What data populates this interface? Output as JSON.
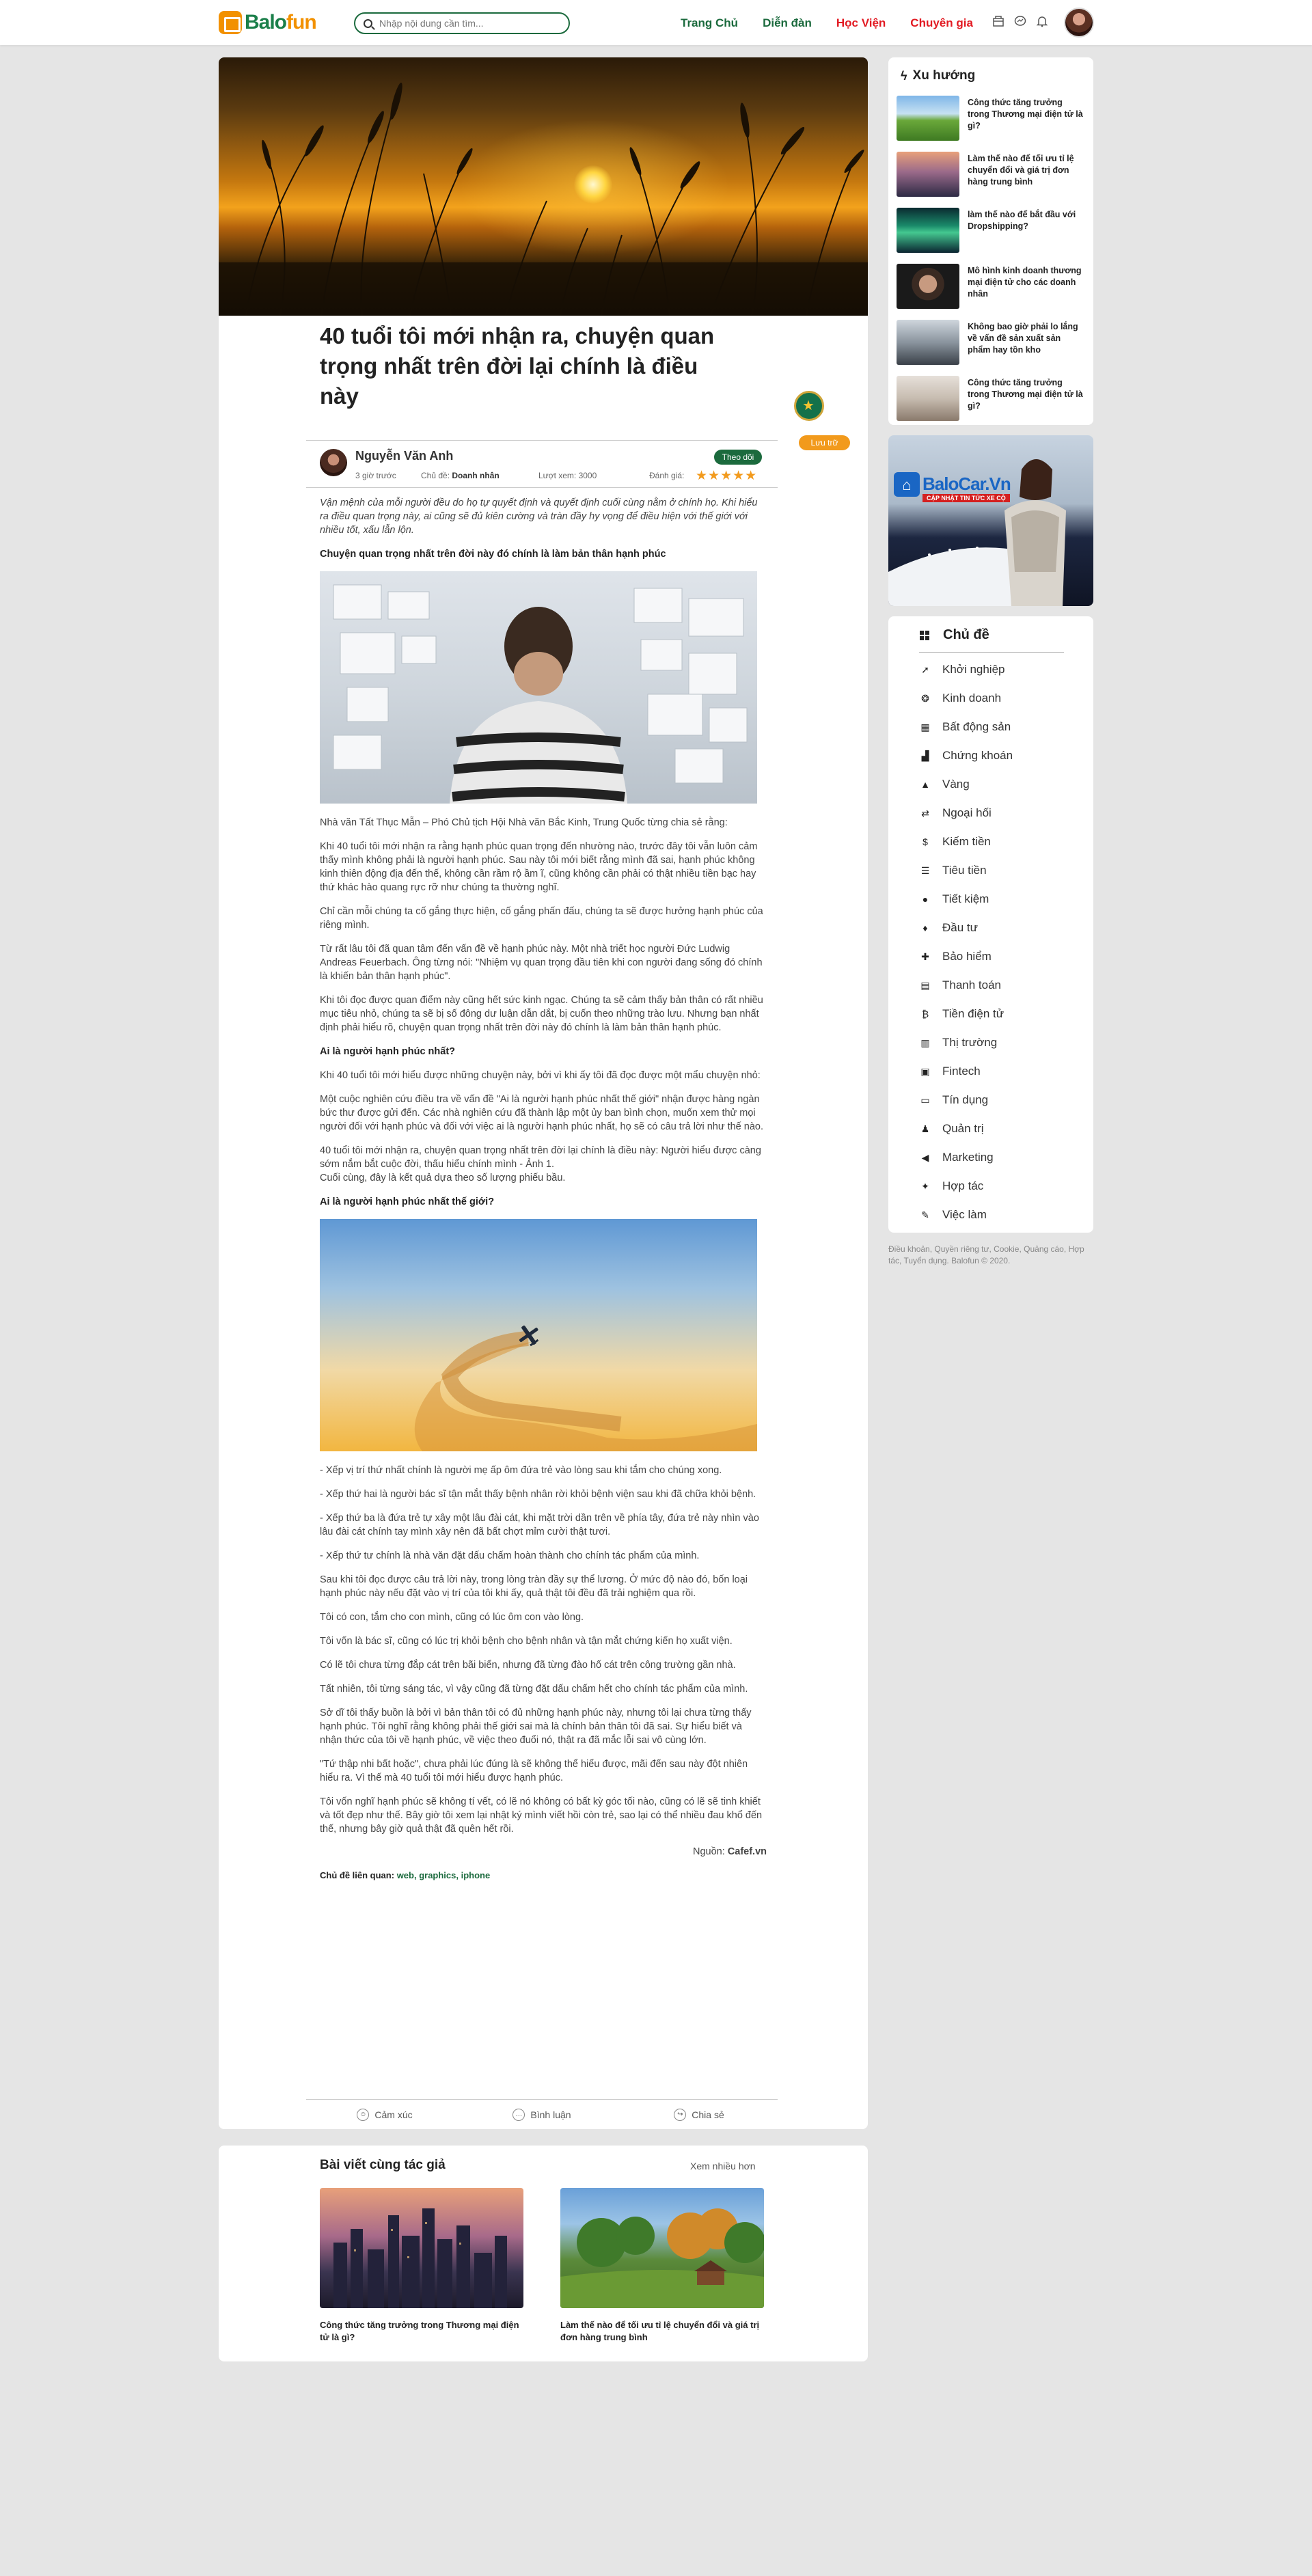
{
  "header": {
    "logo_text_a": "Balo",
    "logo_text_b": "fun",
    "search_placeholder": "Nhập nội dung cần tìm...",
    "nav": [
      {
        "label": "Trang Chủ",
        "color": "#1b6a3d"
      },
      {
        "label": "Diễn đàn",
        "color": "#1b6a3d"
      },
      {
        "label": "Học Viện",
        "color": "#e21b23"
      },
      {
        "label": "Chuyên gia",
        "color": "#e21b23"
      }
    ],
    "icons": [
      "bookmark-icon",
      "messenger-icon",
      "bell-icon"
    ]
  },
  "article": {
    "title": "40 tuổi tôi mới nhận ra, chuyện quan trọng nhất trên đời lại chính là điều này",
    "save_label": "Lưu trữ",
    "author": "Nguyễn Văn Anh",
    "follow_label": "Theo dõi",
    "time": "3 giờ trước",
    "topic_label": "Chủ đề:",
    "topic_value": "Doanh nhân",
    "views": "Lượt xem: 3000",
    "rating_label": "Đánh giá:",
    "rating": 5,
    "lead": "Vận mệnh của mỗi người đều do họ tự quyết định và quyết định cuối cùng nằm ở chính họ. Khi hiểu ra điều quan trọng này, ai cũng sẽ đủ kiên cường và tràn đầy hy vọng để điều hiện với thế giới với nhiều tốt, xấu lẫn lộn.",
    "h1": "Chuyện quan trọng nhất trên đời này đó chính là làm bản thân hạnh phúc",
    "p1": "Nhà văn Tất Thục Mẫn – Phó Chủ tịch Hội Nhà văn Bắc Kinh, Trung Quốc từng chia sẻ rằng:",
    "p2": "Khi 40 tuổi tôi mới nhận ra rằng hạnh phúc quan trọng đến nhường nào, trước đây tôi vẫn luôn cảm thấy mình không phải là người hạnh phúc. Sau này tôi mới biết rằng mình đã sai, hạnh phúc không kinh thiên động địa đến thế, không cần rầm rộ ầm ĩ, cũng không cần phải có thật nhiều tiền bạc hay thứ khác hào quang rực rỡ như chúng ta thường nghĩ.",
    "p3": "Chỉ cần mỗi chúng ta cố gắng thực hiện, cố gắng phấn đấu, chúng ta sẽ được hưởng hạnh phúc của riêng mình.",
    "p4": "Từ rất lâu tôi đã quan tâm đến vấn đề về hạnh phúc này. Một nhà triết học người Đức Ludwig Andreas Feuerbach. Ông từng nói: \"Nhiệm vụ quan trọng đầu tiên khi con người đang sống đó chính là khiến bản thân hạnh phúc\".",
    "p5": "Khi tôi đọc được quan điểm này cũng hết sức kinh ngạc. Chúng ta sẽ cảm thấy bản thân có rất nhiều mục tiêu nhỏ, chúng ta sẽ bị số đông dư luận dẫn dắt, bị cuốn theo những trào lưu. Nhưng bạn nhất định phải hiểu rõ, chuyện quan trọng nhất trên đời này đó chính là làm bản thân hạnh phúc.",
    "h2": "Ai là người hạnh phúc nhất?",
    "p6": "Khi 40 tuổi tôi mới hiểu được những chuyện này, bởi vì khi ấy tôi đã đọc được một mẩu chuyện nhỏ:",
    "p7": "Một cuộc nghiên cứu điều tra về vấn đề \"Ai là người hạnh phúc nhất thế giới\" nhận được hàng ngàn bức thư được gửi đến. Các nhà nghiên cứu đã thành lập một ủy ban bình chọn, muốn xem thử mọi người đối với hạnh phúc và đối với việc ai là người hạnh phúc nhất, họ sẽ có câu trả lời như thế nào.",
    "p8a": "40 tuổi tôi mới nhận ra, chuyện quan trọng nhất trên đời lại chính là điều này: Người hiểu được càng sớm nắm bắt cuộc đời, thấu hiểu chính mình - Ảnh 1.",
    "p8b": "Cuối cùng, đây là kết quả dựa theo số lượng phiếu bầu.",
    "h3": "Ai là người hạnh phúc nhất thế giới?",
    "b1": "- Xếp vị trí thứ nhất chính là người mẹ ấp ôm đứa trẻ vào lòng sau khi tắm cho chúng xong.",
    "b2": "- Xếp thứ hai là người bác sĩ tận mắt thấy bệnh nhân rời khỏi bệnh viện sau khi đã chữa khỏi bệnh.",
    "b3": "- Xếp thứ ba là đứa trẻ tự xây một lâu đài cát, khi mặt trời dần trên về phía tây, đứa trẻ này nhìn vào lâu đài cát chính tay mình xây nên đã bất chợt mỉm cười thật tươi.",
    "b4": "- Xếp thứ tư chính là nhà văn đặt dấu chấm hoàn thành cho chính tác phẩm của mình.",
    "p9": "Sau khi tôi đọc được câu trả lời này, trong lòng tràn đầy sự thể lương. Ở mức độ nào đó, bốn loại hạnh phúc này nếu đặt vào vị trí của tôi khi ấy, quả thật tôi đều đã trải nghiệm qua rồi.",
    "p10": "Tôi có con, tắm cho con mình, cũng có lúc ôm con vào lòng.",
    "p11": "Tôi vốn là bác sĩ, cũng có lúc trị khỏi bệnh cho bệnh nhân và tận mắt chứng kiến họ xuất viện.",
    "p12": "Có lẽ tôi chưa từng đắp cát trên bãi biển, nhưng đã từng đào hố cát trên công trường gần nhà.",
    "p13": "Tất nhiên, tôi từng sáng tác, vì vậy cũng đã từng đặt dấu chấm hết cho chính tác phẩm của mình.",
    "p14": "Sở dĩ tôi thấy buồn là bởi vì bản thân tôi có đủ những hạnh phúc này, nhưng tôi lại chưa từng thấy hạnh phúc. Tôi nghĩ rằng không phải thế giới sai mà là chính bản thân tôi đã sai. Sự hiểu biết và nhận thức của tôi về hạnh phúc, về việc theo đuổi nó, thật ra đã mắc lỗi sai vô cùng lớn.",
    "p15": "\"Tứ thập nhi bất hoặc\", chưa phải lúc đúng là sẽ không thể hiểu được, mãi đến sau này đột nhiên hiểu ra. Vì thế mà 40 tuổi tôi mới hiểu được hạnh phúc.",
    "p16": "Tôi vốn nghĩ hạnh phúc sẽ không tí vết, có lẽ nó không có bất kỳ góc tối nào, cũng có lẽ sẽ tinh khiết và tốt đẹp như thế. Bây giờ tôi xem lại nhật ký mình viết hồi còn trẻ, sao lại có thể nhiều đau khổ đến thế, nhưng bây giờ quả thật đã quên hết rồi.",
    "source_label": "Nguồn:",
    "source_value": "Cafef.vn",
    "tags_label": "Chủ đề liên quan:",
    "tags_value": "web, graphics, iphone",
    "actions": [
      "Cảm xúc",
      "Bình luận",
      "Chia sẻ"
    ]
  },
  "related": {
    "title": "Bài viết cùng tác giả",
    "more": "Xem nhiều hơn",
    "items": [
      "Công thức tăng trưởng trong Thương mại điện tử là gì?",
      "Làm thế nào để tối ưu tỉ lệ chuyển đổi và giá trị đơn hàng trung bình"
    ]
  },
  "trending": {
    "title": "Xu hướng",
    "items": [
      "Công thức tăng trưởng trong Thương mại điện tử là gì?",
      "Làm thế nào để tối ưu tỉ lệ chuyển đổi và giá trị đơn hàng trung bình",
      "làm thế nào để bắt  đầu với Dropshipping?",
      "Mô hình kinh doanh thương mại điện tử cho các doanh nhân",
      "Không bao giờ phải lo lắng về vấn đề sản xuất sản phẩm hay tồn kho",
      "Công thức tăng trưởng trong Thương mại điện tử là gì?"
    ]
  },
  "ad": {
    "brand": "BaloCar.Vn",
    "tagline": "CẬP NHẬT TIN TỨC XE CỘ"
  },
  "topics": {
    "title": "Chủ đề",
    "items": [
      {
        "label": "Khởi nghiệp",
        "icon": "rocket-icon"
      },
      {
        "label": "Kinh doanh",
        "icon": "handshake-icon"
      },
      {
        "label": "Bất động sản",
        "icon": "building-icon"
      },
      {
        "label": "Chứng khoán",
        "icon": "chart-icon"
      },
      {
        "label": "Vàng",
        "icon": "gold-icon"
      },
      {
        "label": "Ngoại hối",
        "icon": "exchange-icon"
      },
      {
        "label": "Kiếm tiền",
        "icon": "money-icon"
      },
      {
        "label": "Tiêu tiền",
        "icon": "cart-icon"
      },
      {
        "label": "Tiết kiệm",
        "icon": "piggy-icon"
      },
      {
        "label": "Đầu tư",
        "icon": "invest-icon"
      },
      {
        "label": "Bảo hiểm",
        "icon": "shield-icon"
      },
      {
        "label": "Thanh toán",
        "icon": "payment-icon"
      },
      {
        "label": "Tiền điện tử",
        "icon": "bitcoin-icon"
      },
      {
        "label": "Thị trường",
        "icon": "market-icon"
      },
      {
        "label": "Fintech",
        "icon": "fintech-icon"
      },
      {
        "label": "Tín dụng",
        "icon": "card-icon"
      },
      {
        "label": "Quản trị",
        "icon": "manage-icon"
      },
      {
        "label": "Marketing",
        "icon": "megaphone-icon"
      },
      {
        "label": "Hợp tác",
        "icon": "partner-icon"
      },
      {
        "label": "Việc làm",
        "icon": "job-icon"
      }
    ]
  },
  "footer": {
    "text": "Điều khoản, Quyền riêng tư, Cookie, Quảng cáo, Hợp tác, Tuyển dụng. Balofun © 2020."
  }
}
